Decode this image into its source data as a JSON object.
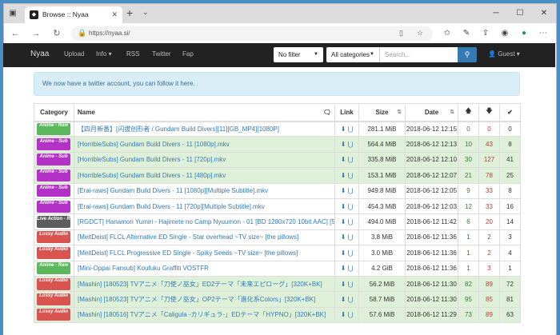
{
  "browser": {
    "tab_title": "Browse :: Nyaa",
    "url": "https://nyaa.si/"
  },
  "navbar": {
    "brand": "Nyaa",
    "links": [
      "Upload",
      "Info",
      "RSS",
      "Twitter",
      "Fap"
    ],
    "filter": "No filter",
    "category": "All categories",
    "search_placeholder": "Search...",
    "user": "Guest"
  },
  "alert": "We now have a twitter account, you can follow it here.",
  "table": {
    "headers": {
      "category": "Category",
      "name": "Name",
      "link": "Link",
      "size": "Size",
      "date": "Date"
    },
    "rows": [
      {
        "badge": "Anime - Raw",
        "badge_color": "#5cb85c",
        "name": "【四月新番】[闪拔创形者 / Gundam Build Divers][11][GB_MP4][1080P]",
        "size": "281.1 MiB",
        "date": "2018-06-12 12:15",
        "seeders": "0",
        "leechers": "0",
        "downloads": "0",
        "status": "default"
      },
      {
        "badge": "Anime - Sub",
        "badge_color": "#b431c7",
        "name": "[HorribleSubs] Gundam Build Divers - 11 [1080p].mkv",
        "size": "564.4 MiB",
        "date": "2018-06-12 12:13",
        "seeders": "10",
        "leechers": "43",
        "downloads": "8",
        "status": "success"
      },
      {
        "badge": "Anime - Sub",
        "badge_color": "#b431c7",
        "name": "[HorribleSubs] Gundam Build Divers - 11 [720p].mkv",
        "size": "335.8 MiB",
        "date": "2018-06-12 12:10",
        "seeders": "30",
        "leechers": "127",
        "downloads": "41",
        "status": "success"
      },
      {
        "badge": "Anime - Sub",
        "badge_color": "#b431c7",
        "name": "[HorribleSubs] Gundam Build Divers - 11 [480p].mkv",
        "size": "153.1 MiB",
        "date": "2018-06-12 12:07",
        "seeders": "21",
        "leechers": "78",
        "downloads": "25",
        "status": "success"
      },
      {
        "badge": "Anime - Sub",
        "badge_color": "#b431c7",
        "name": "[Erai-raws] Gundam Build Divers - 11 [1080p][Multiple Subtitle].mkv",
        "size": "949.8 MiB",
        "date": "2018-06-12 12:05",
        "seeders": "9",
        "leechers": "33",
        "downloads": "8",
        "status": "default"
      },
      {
        "badge": "Anime - Sub",
        "badge_color": "#b431c7",
        "name": "[Erai-raws] Gundam Build Divers - 11 [720p][Multiple Subtitle].mkv",
        "size": "454.3 MiB",
        "date": "2018-06-12 12:03",
        "seeders": "12",
        "leechers": "33",
        "downloads": "16",
        "status": "default"
      },
      {
        "badge": "Live Action - Raw",
        "badge_color": "#5d5d5d",
        "name": "[RGDCT] Hanamori Yumiri - Hajimete no Camp Nyuumon - 01 [BD 1280x720 10bit AAC] [5...",
        "size": "494.0 MiB",
        "date": "2018-06-12 11:42",
        "seeders": "6",
        "leechers": "20",
        "downloads": "14",
        "status": "default"
      },
      {
        "badge": "Lossy Audio",
        "badge_color": "#d9534f",
        "name": "[MeitDeist] FLCL Alternative ED Single - Star overhead ~TV size~ [the pillows]",
        "size": "3.8 MiB",
        "date": "2018-06-12 11:36",
        "seeders": "1",
        "leechers": "2",
        "downloads": "3",
        "status": "default"
      },
      {
        "badge": "Lossy Audio",
        "badge_color": "#d9534f",
        "name": "[MeitDeist] FLCL Progressive ED Single - Spiky Seeds ~TV size~ [the pillows]",
        "size": "3.0 MiB",
        "date": "2018-06-12 11:36",
        "seeders": "1",
        "leechers": "2",
        "downloads": "4",
        "status": "default"
      },
      {
        "badge": "Anime - Raw",
        "badge_color": "#5cb85c",
        "name": "[Mini-Oppai Fansub] Koufuku Graffiti VOSTFR",
        "size": "4.2 GiB",
        "date": "2018-06-12 11:36",
        "seeders": "1",
        "leechers": "3",
        "downloads": "1",
        "status": "default"
      },
      {
        "badge": "Lossy Audio",
        "badge_color": "#d9534f",
        "name": "[Mashin] [180523] TVアニメ「刀使ノ巫女」ED2テーマ「未来エピローグ」[320K+BK]",
        "size": "56.2 MiB",
        "date": "2018-06-12 11:30",
        "seeders": "82",
        "leechers": "89",
        "downloads": "72",
        "status": "success"
      },
      {
        "badge": "Lossy Audio",
        "badge_color": "#d9534f",
        "name": "[Mashin] [180523] TVアニメ「刀使ノ巫女」OP2テーマ「進化系Colors」[320K+BK]",
        "size": "58.7 MiB",
        "date": "2018-06-12 11:30",
        "seeders": "95",
        "leechers": "85",
        "downloads": "81",
        "status": "success"
      },
      {
        "badge": "Lossy Audio",
        "badge_color": "#d9534f",
        "name": "[Mashin] [180516] TVアニメ「Caligula -カリギュラ-」EDテーマ「HYPNO」[320K+BK]",
        "size": "57.6 MiB",
        "date": "2018-06-12 11:29",
        "seeders": "73",
        "leechers": "89",
        "downloads": "63",
        "status": "success"
      }
    ]
  }
}
